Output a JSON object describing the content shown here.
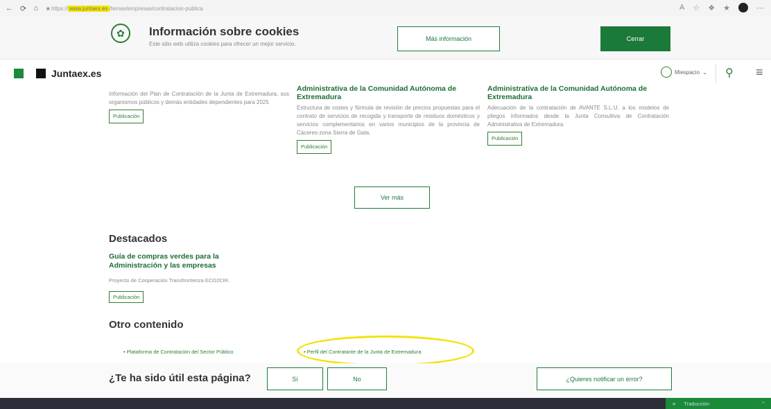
{
  "browser": {
    "url_prefix": "https://",
    "url_highlight": "www.juntaex.es",
    "url_rest": "/temas/empresas/contratacion-publica"
  },
  "cookie_banner": {
    "title": "Información sobre cookies",
    "text": "Este sitio web utiliza cookies para ofrecer un mejor servicio.",
    "more_label": "Más información",
    "close_label": "Cerrar"
  },
  "header": {
    "logo_text": "Juntaex.es",
    "miespacio_label": "Miespacio"
  },
  "cards": [
    {
      "title": "",
      "text": "Información del Plan de Contratación de la Junta de Extremadura, sus organismos públicos y demás entidades dependientes para 2025",
      "pub_label": "Publicación"
    },
    {
      "title": "Administrativa de la Comunidad Autónoma de Extremadura",
      "text": "Estructura de costes y fórmula de revisión de precios propuestas para el contrato de servicios de recogida y transporte de residuos domésticos y servicios complementarios en varios municipios de la provincia de Cáceres-zona Sierra de Gata.",
      "pub_label": "Publicación"
    },
    {
      "title": "Administrativa de la Comunidad Autónoma de Extremadura",
      "text": "Adecuación de la contratación de AVANTE S.L.U. a los modelos de pliegos informados desde la Junta Consultiva de Contratación Administrativa de Extremadura",
      "pub_label": "Publicación"
    }
  ],
  "ver_mas_label": "Ver más",
  "destacados": {
    "title": "Destacados",
    "link": "Guía de compras verdes para la Administración y las empresas",
    "text": "Proyecto de Cooperación Transfronteriza ECO2CIR.",
    "pub_label": "Publicación"
  },
  "otro": {
    "title": "Otro contenido",
    "links": [
      "Plataforma de Contratación del Sector Público",
      "Perfil del Contratante de la Junta de Extremadura"
    ]
  },
  "feedback": {
    "question": "¿Te ha sido útil esta página?",
    "yes_label": "Sí",
    "no_label": "No",
    "report_label": "¿Quieres notificar un error?"
  },
  "translate_label": "Traducción",
  "colors": {
    "brand_green": "#1b7a3a",
    "highlight_yellow": "#f4e20f"
  }
}
